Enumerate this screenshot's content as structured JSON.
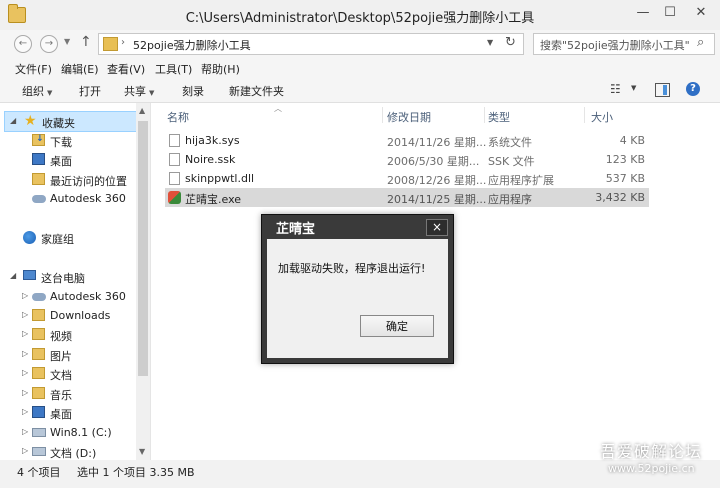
{
  "titlebar": {
    "title": "C:\\Users\\Administrator\\Desktop\\52pojie强力删除小工具",
    "minimize": "—",
    "maximize": "☐",
    "close": "✕"
  },
  "address": {
    "back": "←",
    "forward": "→",
    "up": "↑",
    "separator": "›",
    "path": "52pojie强力删除小工具",
    "refresh": "↻"
  },
  "search": {
    "placeholder": "搜索\"52pojie强力删除小工具\"",
    "icon": "search-icon"
  },
  "menu": [
    "文件(F)",
    "编辑(E)",
    "查看(V)",
    "工具(T)",
    "帮助(H)"
  ],
  "toolbar": {
    "organize": "组织",
    "open": "打开",
    "share": "共享",
    "burn": "刻录",
    "new_folder": "新建文件夹",
    "view_icon": "☷",
    "help": "?"
  },
  "nav": {
    "favorites": "收藏夹",
    "downloads": "下载",
    "desktop": "桌面",
    "recent": "最近访问的位置",
    "autodesk_fav": "Autodesk 360",
    "homegroup": "家庭组",
    "this_pc": "这台电脑",
    "autodesk_pc": "Autodesk 360",
    "downloads_pc": "Downloads",
    "videos": "视频",
    "pictures": "图片",
    "documents": "文档",
    "music": "音乐",
    "desktop_pc": "桌面",
    "drive_c": "Win8.1 (C:)",
    "drive_d": "文档 (D:)"
  },
  "columns": {
    "name": "名称",
    "date": "修改日期",
    "type": "类型",
    "size": "大小"
  },
  "files": [
    {
      "name": "hija3k.sys",
      "date": "2014/11/26 星期...",
      "type": "系统文件",
      "size": "4 KB"
    },
    {
      "name": "Noire.ssk",
      "date": "2006/5/30 星期...",
      "type": "SSK 文件",
      "size": "123 KB"
    },
    {
      "name": "skinppwtl.dll",
      "date": "2008/12/26 星期...",
      "type": "应用程序扩展",
      "size": "537 KB"
    },
    {
      "name": "芷晴宝.exe",
      "date": "2014/11/25 星期...",
      "type": "应用程序",
      "size": "3,432 KB"
    }
  ],
  "status": {
    "count": "4 个项目",
    "selected": "选中 1 个项目  3.35 MB"
  },
  "dialog": {
    "title": "芷晴宝",
    "message": "加载驱动失败，程序退出运行!",
    "ok": "确定",
    "close": "×"
  },
  "watermark": {
    "text": "吾爱破解论坛",
    "url": "www.52pojie.cn"
  }
}
